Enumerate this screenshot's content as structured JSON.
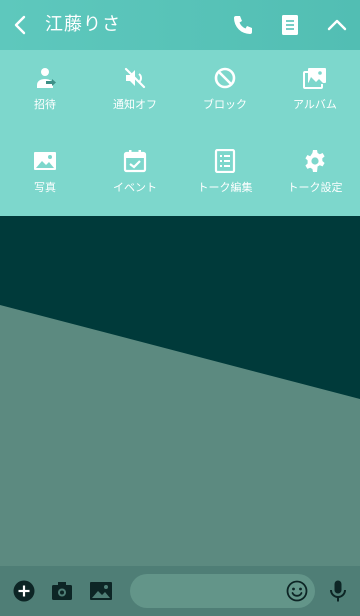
{
  "header": {
    "title": "江藤りさ",
    "icons": [
      "back-icon",
      "phone-icon",
      "notes-icon",
      "collapse-icon"
    ]
  },
  "menu": {
    "items": [
      {
        "label": "招待",
        "icon": "invite-icon"
      },
      {
        "label": "通知オフ",
        "icon": "notifications-off-icon"
      },
      {
        "label": "ブロック",
        "icon": "block-icon"
      },
      {
        "label": "アルバム",
        "icon": "album-icon"
      },
      {
        "label": "写真",
        "icon": "photo-icon"
      },
      {
        "label": "イベント",
        "icon": "event-icon"
      },
      {
        "label": "トーク編集",
        "icon": "edit-talk-icon"
      },
      {
        "label": "トーク設定",
        "icon": "talk-settings-icon"
      }
    ]
  },
  "footer": {
    "icons": [
      "add-icon",
      "camera-icon",
      "image-icon",
      "emoji-icon",
      "microphone-icon"
    ]
  },
  "colors": {
    "header": "#5ec8bd",
    "menu": "#7dd7cc",
    "chat_dark": "#003a3a",
    "chat_slope": "#5c8a80",
    "footer": "#4f7e76"
  }
}
